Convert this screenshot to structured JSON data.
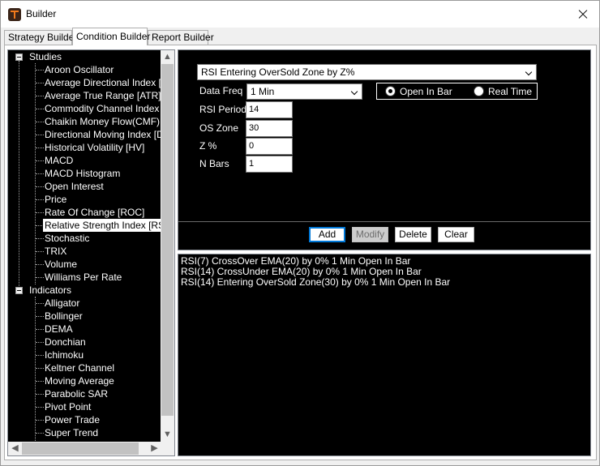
{
  "window": {
    "title": "Builder"
  },
  "tabs": [
    "Strategy Builder",
    "Condition Builder",
    "Report Builder"
  ],
  "active_tab": "Condition Builder",
  "tree": {
    "groups": [
      {
        "label": "Studies",
        "expanded": true,
        "items": [
          "Aroon Oscillator",
          "Average Directional Index [AD",
          "Average True Range [ATR]",
          "Commodity Channel Index [CC",
          "Chaikin Money Flow(CMF)",
          "Directional Moving Index [DMI",
          "Historical Volatility [HV]",
          "MACD",
          "MACD Histogram",
          "Open Interest",
          "Price",
          "Rate Of Change [ROC]",
          "Relative Strength Index [RSI]",
          "Stochastic",
          "TRIX",
          "Volume",
          "Williams Per Rate"
        ]
      },
      {
        "label": "Indicators",
        "expanded": true,
        "items": [
          "Alligator",
          "Bollinger",
          "DEMA",
          "Donchian",
          "Ichimoku",
          "Keltner Channel",
          "Moving Average",
          "Parabolic SAR",
          "Pivot Point",
          "Power Trade",
          "Super Trend"
        ]
      }
    ],
    "selected": "Relative Strength Index [RSI]"
  },
  "editor": {
    "condition_type": "RSI Entering OverSold Zone by Z%",
    "data_freq_label": "Data Freq",
    "data_freq_value": "1 Min",
    "fields": [
      {
        "label": "RSI Period",
        "value": "14"
      },
      {
        "label": "OS Zone",
        "value": "30"
      },
      {
        "label": "Z %",
        "value": "0"
      },
      {
        "label": "N Bars",
        "value": "1"
      }
    ],
    "bar_options": [
      {
        "label": "Open In Bar",
        "checked": true
      },
      {
        "label": "Real Time",
        "checked": false
      }
    ],
    "buttons": {
      "add": "Add",
      "modify": "Modify",
      "delete": "Delete",
      "clear": "Clear"
    }
  },
  "conditions": [
    "RSI(7) CrossOver EMA(20) by 0% 1 Min Open In Bar",
    "RSI(14) CrossUnder EMA(20) by 0% 1 Min Open In Bar",
    "RSI(14) Entering OverSold Zone(30) by 0% 1 Min Open In Bar"
  ],
  "colors": {
    "panel_bg": "#000000",
    "text_on_panel": "#ffffff",
    "default_button_border": "#0078d7",
    "app_icon": "#f07a1c"
  }
}
